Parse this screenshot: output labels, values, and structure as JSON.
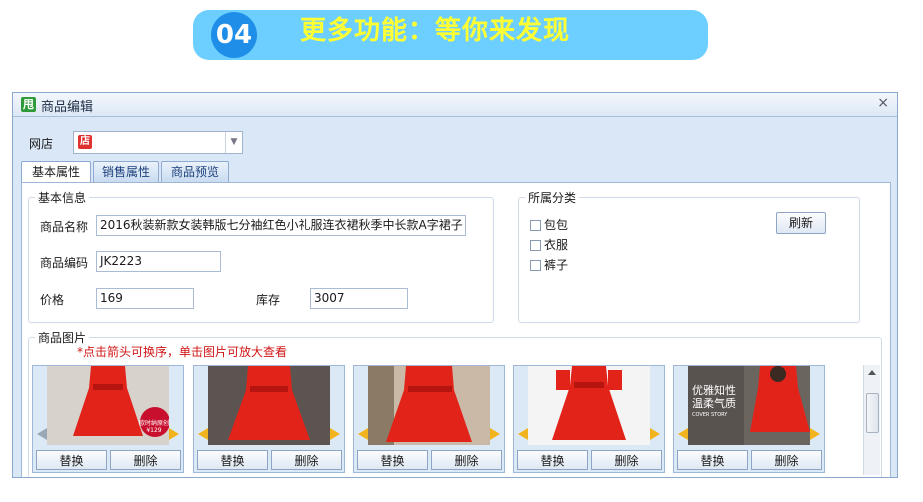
{
  "banner": {
    "number": "04",
    "title": "更多功能：等你来发现"
  },
  "window": {
    "title": "商品编辑",
    "close": "×",
    "app_icon": "甩"
  },
  "shop": {
    "label": "网店",
    "icon_text": "店",
    "value": ""
  },
  "tabs": [
    "基本属性",
    "销售属性",
    "商品预览"
  ],
  "basic_info": {
    "legend": "基本信息",
    "name_label": "商品名称",
    "name_value": "2016秋装新款女装韩版七分袖红色小礼服连衣裙秋季中长款A字裙子",
    "code_label": "商品编码",
    "code_value": "JK2223",
    "price_label": "价格",
    "price_value": "169",
    "stock_label": "库存",
    "stock_value": "3007"
  },
  "category": {
    "legend": "所属分类",
    "refresh_label": "刷新",
    "items": [
      {
        "label": "包包",
        "checked": false
      },
      {
        "label": "衣服",
        "checked": false
      },
      {
        "label": "裤子",
        "checked": false
      }
    ]
  },
  "images": {
    "legend": "商品图片",
    "hint": "*点击箭头可换序，单击图片可放大查看",
    "replace_label": "替换",
    "delete_label": "删除",
    "thumb_count": 5,
    "overlay_badge": "欧时纳原创 ¥129",
    "overlay_banner": "优雅知性 温柔气质",
    "overlay_banner_sub": "COVER STORY"
  },
  "colors": {
    "dress_red": "#e2231a",
    "arrow_yellow": "#f2b41d",
    "banner_blue": "#6ccfff",
    "banner_text": "#ffff33"
  }
}
